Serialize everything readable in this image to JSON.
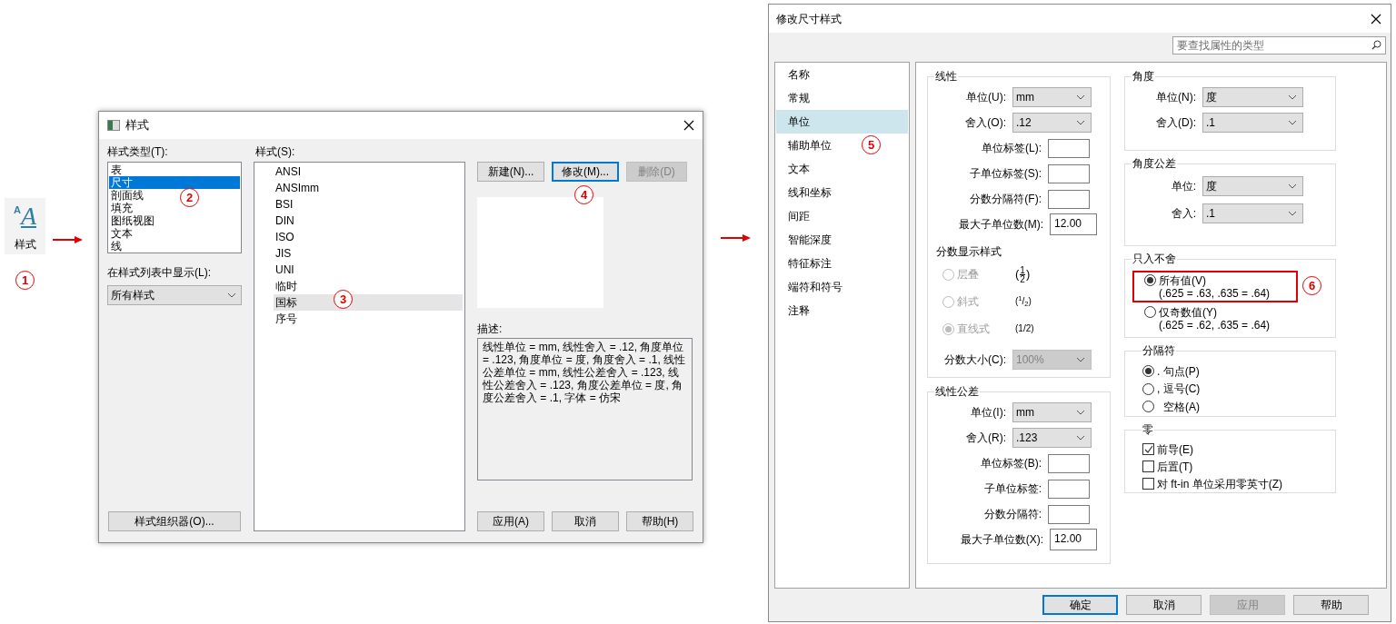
{
  "launcher": {
    "icon_letters": [
      "A",
      "A"
    ],
    "label": "样式"
  },
  "callouts": [
    "1",
    "2",
    "3",
    "4",
    "5",
    "6"
  ],
  "styles_dialog": {
    "title": "样式",
    "type_label": "样式类型(T):",
    "types": [
      {
        "label": "表",
        "selected": false
      },
      {
        "label": "尺寸",
        "selected": true
      },
      {
        "label": "剖面线",
        "selected": false
      },
      {
        "label": "填充",
        "selected": false
      },
      {
        "label": "图纸视图",
        "selected": false
      },
      {
        "label": "文本",
        "selected": false
      },
      {
        "label": "线",
        "selected": false
      }
    ],
    "filter_label": "在样式列表中显示(L):",
    "filter_value": "所有样式",
    "organizer_button": "样式组织器(O)...",
    "styles_label": "样式(S):",
    "styles": [
      {
        "label": "ANSI",
        "selected": false
      },
      {
        "label": "ANSImm",
        "selected": false
      },
      {
        "label": "BSI",
        "selected": false
      },
      {
        "label": "DIN",
        "selected": false
      },
      {
        "label": "ISO",
        "selected": false
      },
      {
        "label": "JIS",
        "selected": false
      },
      {
        "label": "UNI",
        "selected": false
      },
      {
        "label": "临时",
        "selected": false
      },
      {
        "label": "国标",
        "selected": true
      },
      {
        "label": "序号",
        "selected": false
      }
    ],
    "buttons": [
      {
        "label": "新建(N)...",
        "focused": false,
        "disabled": false
      },
      {
        "label": "修改(M)...",
        "focused": true,
        "disabled": false
      },
      {
        "label": "删除(D)",
        "focused": false,
        "disabled": true
      }
    ],
    "description_label": "描述:",
    "description": "线性单位 = mm, 线性舍入 = .12, 角度单位 = .123, 角度单位 = 度, 角度舍入 = .1, 线性公差单位 = mm, 线性公差舍入 = .123, 线性公差舍入 = .123, 角度公差单位 = 度, 角度公差舍入 = .1, 字体 = 仿宋",
    "footer_buttons": [
      {
        "label": "应用(A)",
        "focused": false,
        "disabled": false
      },
      {
        "label": "取消",
        "focused": false,
        "disabled": false
      },
      {
        "label": "帮助(H)",
        "focused": false,
        "disabled": false
      }
    ]
  },
  "modify_dialog": {
    "title": "修改尺寸样式",
    "search": {
      "placeholder": "要查找属性的类型"
    },
    "nav": [
      {
        "label": "名称",
        "selected": false
      },
      {
        "label": "常规",
        "selected": false
      },
      {
        "label": "单位",
        "selected": true
      },
      {
        "label": "辅助单位",
        "selected": false
      },
      {
        "label": "文本",
        "selected": false
      },
      {
        "label": "线和坐标",
        "selected": false
      },
      {
        "label": "间距",
        "selected": false
      },
      {
        "label": "智能深度",
        "selected": false
      },
      {
        "label": "特征标注",
        "selected": false
      },
      {
        "label": "端符和符号",
        "selected": false
      },
      {
        "label": "注释",
        "selected": false
      }
    ],
    "linear": {
      "title": "线性",
      "rows": [
        {
          "kind": "select",
          "label": "单位(U):",
          "value": "mm"
        },
        {
          "kind": "select",
          "label": "舍入(O):",
          "value": ".12"
        },
        {
          "kind": "input",
          "label": "单位标签(L):"
        },
        {
          "kind": "input",
          "label": "子单位标签(S):"
        },
        {
          "kind": "input",
          "label": "分数分隔符(F):"
        },
        {
          "kind": "input",
          "label": "最大子单位数(M):",
          "value": "12.00"
        }
      ],
      "fraction_title": "分数显示样式",
      "fraction_options": [
        {
          "label": "层叠",
          "selected": false,
          "disabled": true,
          "kind": "stacked",
          "sample": [
            "(",
            "1",
            "2",
            ")"
          ]
        },
        {
          "label": "斜式",
          "selected": false,
          "disabled": true,
          "kind": "text",
          "sample": "($^{1}$/$_{2}$)"
        },
        {
          "label": "直线式",
          "selected": true,
          "disabled": true,
          "kind": "text",
          "sample": "(1/2)"
        }
      ],
      "fraction_size": {
        "label": "分数大小(C):",
        "value": "100%",
        "disabled": true
      }
    },
    "linear_tolerance": {
      "title": "线性公差",
      "rows": [
        {
          "kind": "select",
          "label": "单位(I):",
          "value": "mm"
        },
        {
          "kind": "select",
          "label": "舍入(R):",
          "value": ".123"
        },
        {
          "kind": "input",
          "label": "单位标签(B):"
        },
        {
          "kind": "input",
          "label": "子单位标签:"
        },
        {
          "kind": "input",
          "label": "分数分隔符:"
        },
        {
          "kind": "input",
          "label": "最大子单位数(X):",
          "value": "12.00"
        }
      ]
    },
    "angle": {
      "title": "角度",
      "rows": [
        {
          "kind": "select",
          "label": "单位(N):",
          "value": "度"
        },
        {
          "kind": "select",
          "label": "舍入(D):",
          "value": ".1"
        }
      ]
    },
    "angle_tolerance": {
      "title": "角度公差",
      "rows": [
        {
          "kind": "select",
          "label": "单位:",
          "value": "度"
        },
        {
          "kind": "select",
          "label": "舍入:",
          "value": ".1"
        }
      ]
    },
    "round_up": {
      "title": "只入不舍",
      "options": [
        {
          "label": "所有值(V)",
          "note": "(.625 = .63, .635 = .64)",
          "selected": true,
          "highlighted": true
        },
        {
          "label": "仅奇数值(Y)",
          "note": "(.625 = .62, .635 = .64)",
          "selected": false,
          "highlighted": false
        }
      ]
    },
    "separator": {
      "title": "分隔符",
      "options": [
        {
          "label": ". 句点(P)",
          "selected": true
        },
        {
          "label": ", 逗号(C)",
          "selected": false
        },
        {
          "label": "空格(A)",
          "selected": false
        }
      ]
    },
    "zeros": {
      "title": "零",
      "options": [
        {
          "label": "前导(E)",
          "checked": true
        },
        {
          "label": "后置(T)",
          "checked": false
        },
        {
          "label": "对 ft-in 单位采用零英寸(Z)",
          "checked": false
        }
      ]
    },
    "footer_buttons": [
      {
        "label": "确定",
        "focused": true,
        "disabled": false
      },
      {
        "label": "取消",
        "focused": false,
        "disabled": false
      },
      {
        "label": "应用",
        "focused": false,
        "disabled": true
      },
      {
        "label": "帮助",
        "focused": false,
        "disabled": false
      }
    ]
  }
}
